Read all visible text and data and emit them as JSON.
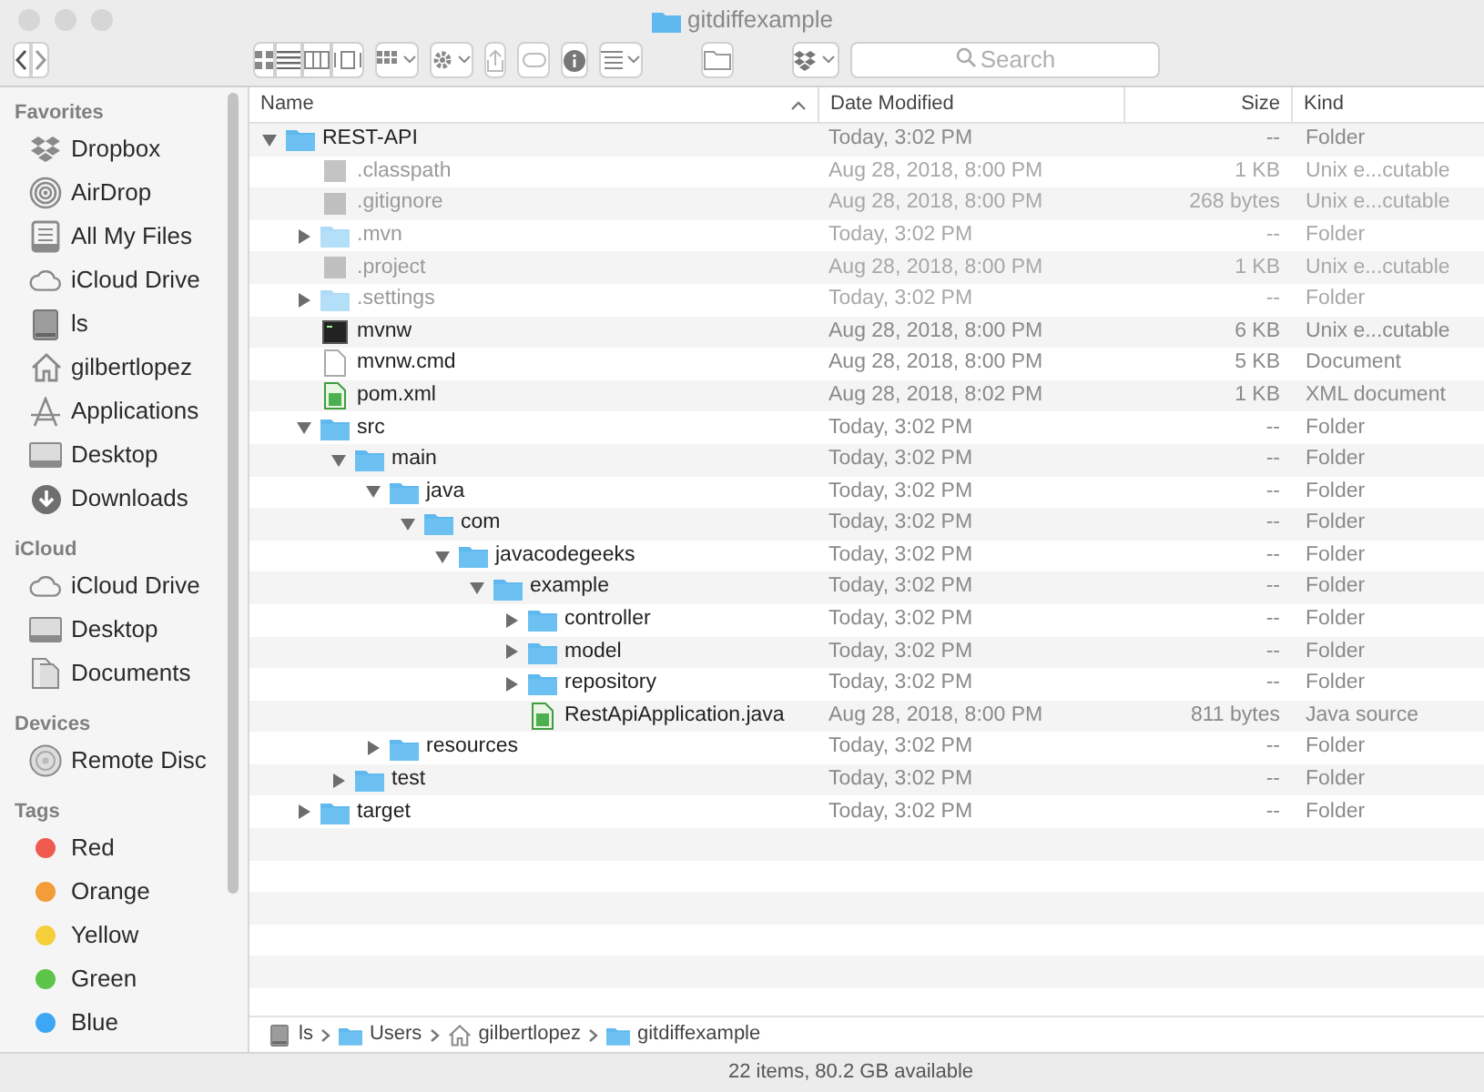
{
  "window": {
    "title": "gitdiffexample"
  },
  "toolbar": {
    "search": {
      "placeholder": "Search"
    }
  },
  "sidebar": {
    "sections": [
      {
        "heading": "Favorites",
        "items": [
          {
            "label": "Dropbox",
            "kind": "dropbox"
          },
          {
            "label": "AirDrop",
            "kind": "airdrop"
          },
          {
            "label": "All My Files",
            "kind": "files"
          },
          {
            "label": "iCloud Drive",
            "kind": "cloud"
          },
          {
            "label": "ls",
            "kind": "disk"
          },
          {
            "label": "gilbertlopez",
            "kind": "home"
          },
          {
            "label": "Applications",
            "kind": "apps"
          },
          {
            "label": "Desktop",
            "kind": "desktop"
          },
          {
            "label": "Downloads",
            "kind": "downloads"
          }
        ]
      },
      {
        "heading": "iCloud",
        "items": [
          {
            "label": "iCloud Drive",
            "kind": "cloud"
          },
          {
            "label": "Desktop",
            "kind": "desktop"
          },
          {
            "label": "Documents",
            "kind": "documents"
          }
        ]
      },
      {
        "heading": "Devices",
        "items": [
          {
            "label": "Remote Disc",
            "kind": "disc"
          }
        ]
      },
      {
        "heading": "Tags",
        "items": [
          {
            "label": "Red",
            "kind": "tag",
            "color": "#f05a4f"
          },
          {
            "label": "Orange",
            "kind": "tag",
            "color": "#f39c38"
          },
          {
            "label": "Yellow",
            "kind": "tag",
            "color": "#f5cf3b"
          },
          {
            "label": "Green",
            "kind": "tag",
            "color": "#5cc448"
          },
          {
            "label": "Blue",
            "kind": "tag",
            "color": "#3ea7f5"
          }
        ]
      }
    ]
  },
  "table": {
    "columns": [
      "Name",
      "Date Modified",
      "Size",
      "Kind"
    ],
    "rows": [
      {
        "name": "REST-API",
        "kind": "folder",
        "hidden": false,
        "expanded": true,
        "date": "Today, 3:02 PM",
        "size": "--",
        "type": "Folder",
        "children": [
          {
            "name": ".classpath",
            "kind": "generic",
            "hidden": true,
            "date": "Aug 28, 2018, 8:00 PM",
            "size": "1 KB",
            "type": "Unix e...cutable"
          },
          {
            "name": ".gitignore",
            "kind": "generic",
            "hidden": true,
            "date": "Aug 28, 2018, 8:00 PM",
            "size": "268 bytes",
            "type": "Unix e...cutable"
          },
          {
            "name": ".mvn",
            "kind": "folder",
            "hidden": true,
            "expanded": false,
            "date": "Today, 3:02 PM",
            "size": "--",
            "type": "Folder"
          },
          {
            "name": ".project",
            "kind": "generic",
            "hidden": true,
            "date": "Aug 28, 2018, 8:00 PM",
            "size": "1 KB",
            "type": "Unix e...cutable"
          },
          {
            "name": ".settings",
            "kind": "folder",
            "hidden": true,
            "expanded": false,
            "date": "Today, 3:02 PM",
            "size": "--",
            "type": "Folder"
          },
          {
            "name": "mvnw",
            "kind": "terminal",
            "hidden": false,
            "date": "Aug 28, 2018, 8:00 PM",
            "size": "6 KB",
            "type": "Unix e...cutable"
          },
          {
            "name": "mvnw.cmd",
            "kind": "document",
            "hidden": false,
            "date": "Aug 28, 2018, 8:00 PM",
            "size": "5 KB",
            "type": "Document"
          },
          {
            "name": "pom.xml",
            "kind": "code",
            "hidden": false,
            "date": "Aug 28, 2018, 8:02 PM",
            "size": "1 KB",
            "type": "XML document"
          },
          {
            "name": "src",
            "kind": "folder",
            "hidden": false,
            "expanded": true,
            "date": "Today, 3:02 PM",
            "size": "--",
            "type": "Folder",
            "children": [
              {
                "name": "main",
                "kind": "folder",
                "hidden": false,
                "expanded": true,
                "date": "Today, 3:02 PM",
                "size": "--",
                "type": "Folder",
                "children": [
                  {
                    "name": "java",
                    "kind": "folder",
                    "hidden": false,
                    "expanded": true,
                    "date": "Today, 3:02 PM",
                    "size": "--",
                    "type": "Folder",
                    "children": [
                      {
                        "name": "com",
                        "kind": "folder",
                        "hidden": false,
                        "expanded": true,
                        "date": "Today, 3:02 PM",
                        "size": "--",
                        "type": "Folder",
                        "children": [
                          {
                            "name": "javacodegeeks",
                            "kind": "folder",
                            "hidden": false,
                            "expanded": true,
                            "date": "Today, 3:02 PM",
                            "size": "--",
                            "type": "Folder",
                            "children": [
                              {
                                "name": "example",
                                "kind": "folder",
                                "hidden": false,
                                "expanded": true,
                                "date": "Today, 3:02 PM",
                                "size": "--",
                                "type": "Folder",
                                "children": [
                                  {
                                    "name": "controller",
                                    "kind": "folder",
                                    "hidden": false,
                                    "expanded": false,
                                    "date": "Today, 3:02 PM",
                                    "size": "--",
                                    "type": "Folder"
                                  },
                                  {
                                    "name": "model",
                                    "kind": "folder",
                                    "hidden": false,
                                    "expanded": false,
                                    "date": "Today, 3:02 PM",
                                    "size": "--",
                                    "type": "Folder"
                                  },
                                  {
                                    "name": "repository",
                                    "kind": "folder",
                                    "hidden": false,
                                    "expanded": false,
                                    "date": "Today, 3:02 PM",
                                    "size": "--",
                                    "type": "Folder"
                                  },
                                  {
                                    "name": "RestApiApplication.java",
                                    "kind": "code",
                                    "hidden": false,
                                    "date": "Aug 28, 2018, 8:00 PM",
                                    "size": "811 bytes",
                                    "type": "Java source"
                                  }
                                ]
                              }
                            ]
                          }
                        ]
                      }
                    ]
                  },
                  {
                    "name": "resources",
                    "kind": "folder",
                    "hidden": false,
                    "expanded": false,
                    "date": "Today, 3:02 PM",
                    "size": "--",
                    "type": "Folder"
                  }
                ]
              },
              {
                "name": "test",
                "kind": "folder",
                "hidden": false,
                "expanded": false,
                "date": "Today, 3:02 PM",
                "size": "--",
                "type": "Folder"
              }
            ]
          },
          {
            "name": "target",
            "kind": "folder",
            "hidden": false,
            "expanded": false,
            "date": "Today, 3:02 PM",
            "size": "--",
            "type": "Folder"
          }
        ]
      }
    ]
  },
  "path_bar": [
    {
      "label": "ls",
      "kind": "disk"
    },
    {
      "label": "Users",
      "kind": "folder"
    },
    {
      "label": "gilbertlopez",
      "kind": "home"
    },
    {
      "label": "gitdiffexample",
      "kind": "folder"
    }
  ],
  "status_bar": "22 items, 80.2 GB available"
}
